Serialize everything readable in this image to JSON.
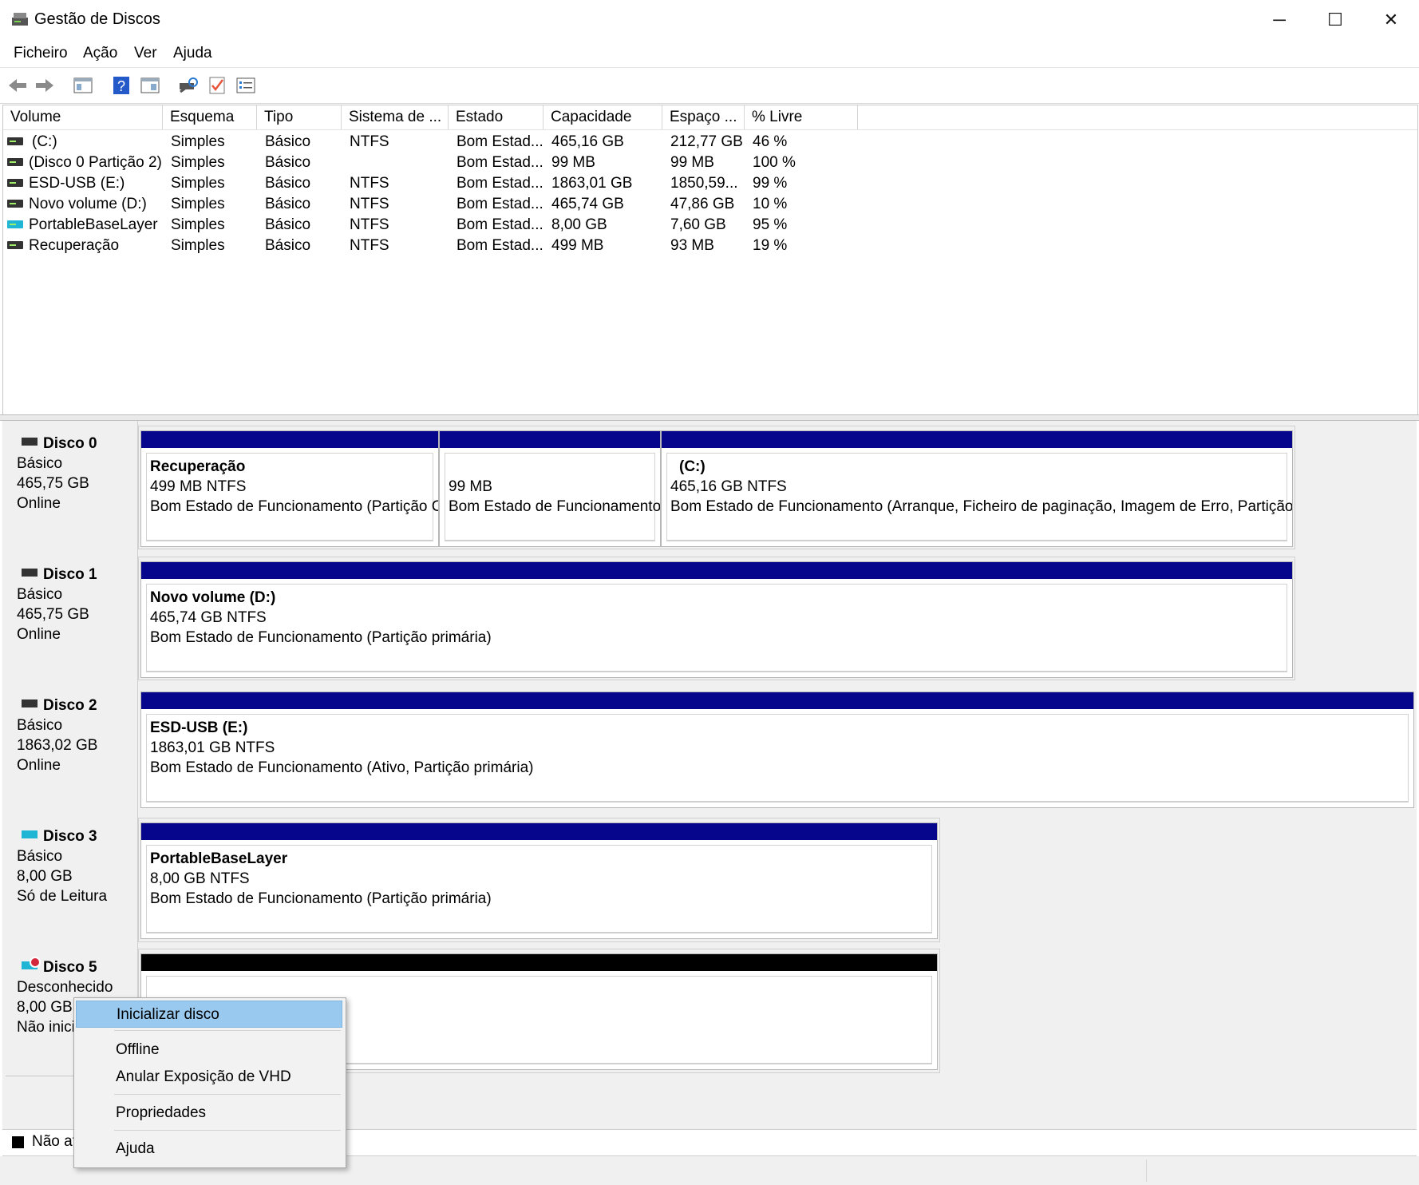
{
  "window": {
    "title": "Gestão de Discos",
    "controls": {
      "minimize": "─",
      "maximize": "☐",
      "close": "✕"
    }
  },
  "menu": [
    "Ficheiro",
    "Ação",
    "Ver",
    "Ajuda"
  ],
  "toolbar": {
    "icons": [
      "back-arrow-icon",
      "forward-arrow-icon",
      "disk-list-icon",
      "help-icon",
      "console-view-icon",
      "rescan-icon",
      "check-icon",
      "properties-icon"
    ]
  },
  "volume_list": {
    "columns": [
      "Volume",
      "Esquema",
      "Tipo",
      "Sistema de ...",
      "Estado",
      "Capacidade",
      "Espaço ...",
      "% Livre"
    ],
    "rows": [
      {
        "volume": "(C:)",
        "esquema": "Simples",
        "tipo": "Básico",
        "sistema": "NTFS",
        "estado": "Bom Estad...",
        "capacidade": "465,16 GB",
        "espaco": "212,77 GB",
        "livre": "46 %",
        "icon": "drive-icon"
      },
      {
        "volume": "(Disco 0 Partição 2)",
        "esquema": "Simples",
        "tipo": "Básico",
        "sistema": "",
        "estado": "Bom Estad...",
        "capacidade": "99 MB",
        "espaco": "99 MB",
        "livre": "100 %",
        "icon": "drive-icon"
      },
      {
        "volume": "ESD-USB (E:)",
        "esquema": "Simples",
        "tipo": "Básico",
        "sistema": "NTFS",
        "estado": "Bom Estad...",
        "capacidade": "1863,01 GB",
        "espaco": "1850,59...",
        "livre": "99 %",
        "icon": "drive-icon"
      },
      {
        "volume": "Novo volume (D:)",
        "esquema": "Simples",
        "tipo": "Básico",
        "sistema": "NTFS",
        "estado": "Bom Estad...",
        "capacidade": "465,74 GB",
        "espaco": "47,86 GB",
        "livre": "10 %",
        "icon": "drive-icon"
      },
      {
        "volume": "PortableBaseLayer",
        "esquema": "Simples",
        "tipo": "Básico",
        "sistema": "NTFS",
        "estado": "Bom Estad...",
        "capacidade": "8,00 GB",
        "espaco": "7,60 GB",
        "livre": "95 %",
        "icon": "drive-icon-teal"
      },
      {
        "volume": "Recuperação",
        "esquema": "Simples",
        "tipo": "Básico",
        "sistema": "NTFS",
        "estado": "Bom Estad...",
        "capacidade": "499 MB",
        "espaco": "93 MB",
        "livre": "19 %",
        "icon": "drive-icon"
      }
    ]
  },
  "disks": [
    {
      "name": "Disco 0",
      "type": "Básico",
      "size": "465,75 GB",
      "status": "Online",
      "partitions": [
        {
          "name": "Recuperação",
          "size": "499 MB NTFS",
          "status": "Bom Estado de Funcionamento (Partição C"
        },
        {
          "name": "",
          "size": "99 MB",
          "status": "Bom Estado de Funcionamento"
        },
        {
          "name": "(C:)",
          "size": "465,16 GB NTFS",
          "status": "Bom Estado de Funcionamento (Arranque, Ficheiro de paginação, Imagem de Erro, Partição p"
        }
      ]
    },
    {
      "name": "Disco 1",
      "type": "Básico",
      "size": "465,75 GB",
      "status": "Online",
      "partitions": [
        {
          "name": "Novo volume  (D:)",
          "size": "465,74 GB NTFS",
          "status": "Bom Estado de Funcionamento (Partição primária)"
        }
      ]
    },
    {
      "name": "Disco 2",
      "type": "Básico",
      "size": "1863,02 GB",
      "status": "Online",
      "partitions": [
        {
          "name": "ESD-USB  (E:)",
          "size": "1863,01 GB NTFS",
          "status": "Bom Estado de Funcionamento (Ativo, Partição primária)"
        }
      ]
    },
    {
      "name": "Disco 3",
      "type": "Básico",
      "size": "8,00 GB",
      "status": "Só de Leitura",
      "partitions": [
        {
          "name": "PortableBaseLayer",
          "size": "8,00 GB NTFS",
          "status": "Bom Estado de Funcionamento (Partição primária)"
        }
      ]
    },
    {
      "name": "Disco 5",
      "type": "Desconhecido",
      "size": "8,00 GB",
      "status": "Não inici",
      "partitions": []
    }
  ],
  "legend": {
    "text": "Não at"
  },
  "context_menu": {
    "items": [
      "Inicializar disco",
      "Offline",
      "Anular Exposição de VHD",
      "Propriedades",
      "Ajuda"
    ],
    "highlighted": "Inicializar disco"
  },
  "colors": {
    "partition_bar": "#06068c",
    "unallocated_bar": "#000000",
    "menu_highlight": "#99c9ef"
  }
}
